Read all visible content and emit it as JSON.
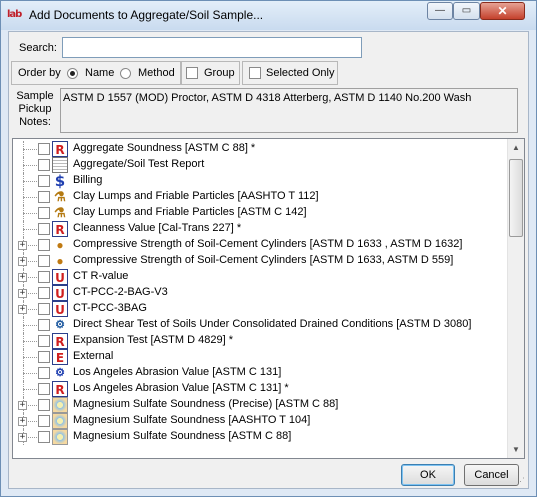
{
  "window": {
    "app_icon_text": "lab",
    "title": "Add Documents to Aggregate/Soil Sample...",
    "minimize_glyph": "—",
    "maximize_glyph": "▭",
    "close_glyph": "✕"
  },
  "search": {
    "label": "Search:",
    "value": "",
    "placeholder": ""
  },
  "order_by": {
    "label": "Order by",
    "options": [
      {
        "label": "Name",
        "selected": true
      },
      {
        "label": "Method",
        "selected": false
      }
    ]
  },
  "group_checkbox": {
    "label": "Group",
    "checked": false
  },
  "selected_only_checkbox": {
    "label": "Selected Only",
    "checked": false
  },
  "notes": {
    "label_line1": "Sample",
    "label_line2": "Pickup",
    "label_line3": "Notes:",
    "text": "ASTM D 1557 (MOD) Proctor, ASTM D 4318 Atterberg, ASTM D 1140 No.200 Wash"
  },
  "documents": [
    {
      "label": "Aggregate Soundness [ASTM C 88] *",
      "icon": "report-R-icon",
      "glyph": "R",
      "expandable": false
    },
    {
      "label": "Aggregate/Soil Test Report",
      "icon": "document-icon",
      "glyph": "",
      "expandable": false
    },
    {
      "label": "Billing",
      "icon": "dollar-icon",
      "glyph": "$",
      "expandable": false
    },
    {
      "label": "Clay Lumps and Friable Particles [AASHTO T 112]",
      "icon": "flask-icon",
      "glyph": "⚗",
      "expandable": false
    },
    {
      "label": "Clay Lumps and Friable Particles [ASTM C 142]",
      "icon": "flask-icon",
      "glyph": "⚗",
      "expandable": false
    },
    {
      "label": "Cleanness Value [Cal-Trans 227] *",
      "icon": "report-R-icon",
      "glyph": "R",
      "expandable": false
    },
    {
      "label": "Compressive Strength of Soil-Cement Cylinders [ASTM D 1633 , ASTM D 1632]",
      "icon": "cylinder-icon",
      "glyph": "●",
      "expandable": true
    },
    {
      "label": "Compressive Strength of Soil-Cement Cylinders [ASTM D 1633, ASTM D 559]",
      "icon": "cylinder-icon",
      "glyph": "●",
      "expandable": true
    },
    {
      "label": "CT R-value",
      "icon": "report-U-icon",
      "glyph": "U",
      "expandable": true
    },
    {
      "label": "CT-PCC-2-BAG-V3",
      "icon": "report-U-icon",
      "glyph": "U",
      "expandable": true
    },
    {
      "label": "CT-PCC-3BAG",
      "icon": "report-U-icon",
      "glyph": "U",
      "expandable": true
    },
    {
      "label": "Direct Shear Test of Soils Under Consolidated Drained Conditions [ASTM D 3080]",
      "icon": "shear-test-icon",
      "glyph": "⚙",
      "expandable": false
    },
    {
      "label": "Expansion Test [ASTM D 4829] *",
      "icon": "report-R-icon",
      "glyph": "R",
      "expandable": false
    },
    {
      "label": "External",
      "icon": "external-E-icon",
      "glyph": "E",
      "expandable": false
    },
    {
      "label": "Los Angeles Abrasion Value [ASTM C 131]",
      "icon": "abrasion-icon",
      "glyph": "⚙",
      "expandable": false
    },
    {
      "label": "Los Angeles Abrasion Value [ASTM C 131] *",
      "icon": "report-R-icon",
      "glyph": "R",
      "expandable": false
    },
    {
      "label": "Magnesium Sulfate Soundness (Precise) [ASTM C 88]",
      "icon": "sulfate-icon",
      "glyph": "",
      "expandable": true
    },
    {
      "label": "Magnesium Sulfate Soundness [AASHTO T 104]",
      "icon": "sulfate-icon",
      "glyph": "",
      "expandable": true
    },
    {
      "label": "Magnesium Sulfate Soundness [ASTM C 88]",
      "icon": "sulfate-icon",
      "glyph": "",
      "expandable": true
    }
  ],
  "buttons": {
    "ok": "OK",
    "cancel": "Cancel"
  }
}
